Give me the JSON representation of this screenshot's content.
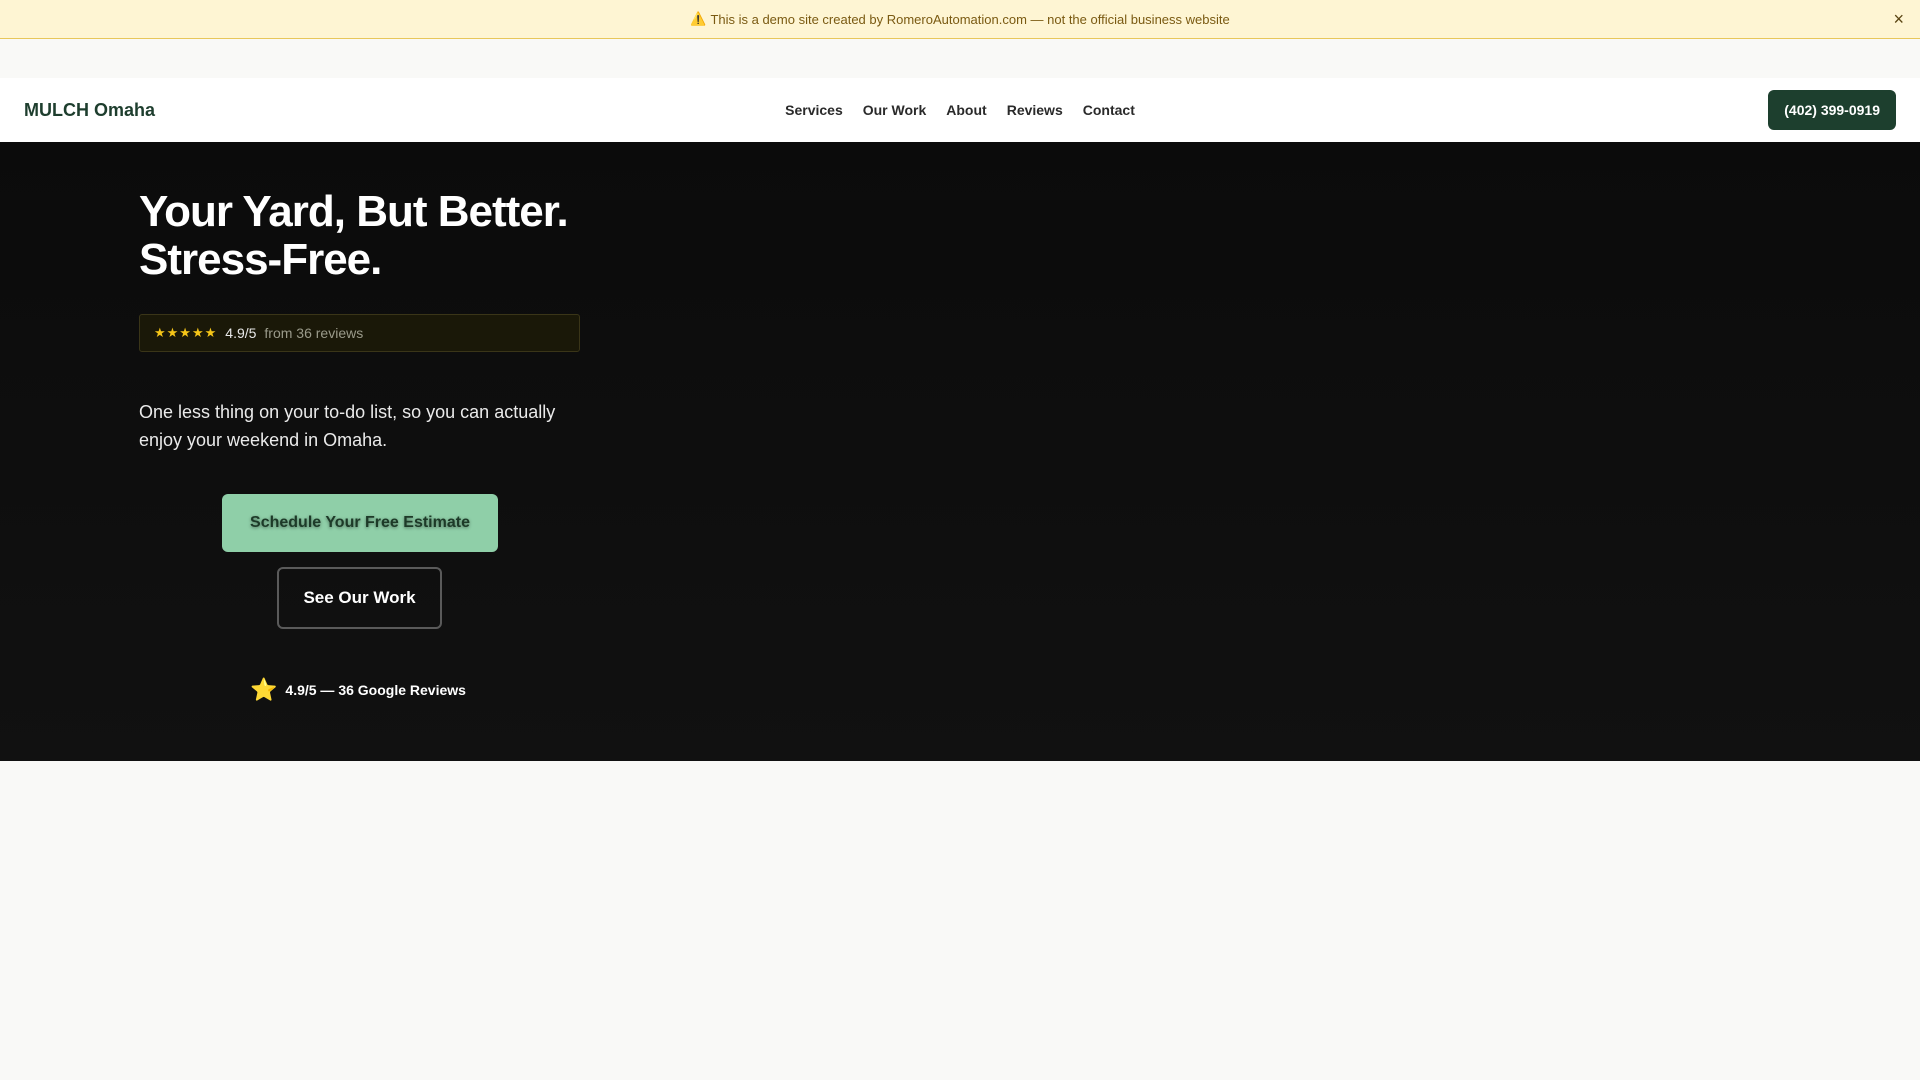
{
  "banner": {
    "warning_icon": "⚠️",
    "text": "This is a demo site created by RomeroAutomation.com — not the official business website",
    "close": "×"
  },
  "header": {
    "logo": "MULCH Omaha",
    "nav": [
      {
        "label": "Services"
      },
      {
        "label": "Our Work"
      },
      {
        "label": "About"
      },
      {
        "label": "Reviews"
      },
      {
        "label": "Contact"
      }
    ],
    "phone": "(402) 399-0919"
  },
  "hero": {
    "title": "Your Yard, But Better. Stress-Free.",
    "rating": {
      "stars": "★★★★★",
      "score": "4.9/5",
      "count": "from 36 reviews"
    },
    "subtitle": "One less thing on your to-do list, so you can actually enjoy your weekend in Omaha.",
    "primary_cta": "Schedule Your Free Estimate",
    "secondary_cta": "See Our Work",
    "google_rating": {
      "icon": "⭐",
      "text": "4.9/5 — 36 Google Reviews"
    }
  },
  "colors": {
    "banner_bg": "#fef5d3",
    "brand_green": "#1d3f2e",
    "cta_green": "#8fcfa8",
    "hero_bg": "#0b0b0b",
    "star": "#f5c518"
  }
}
